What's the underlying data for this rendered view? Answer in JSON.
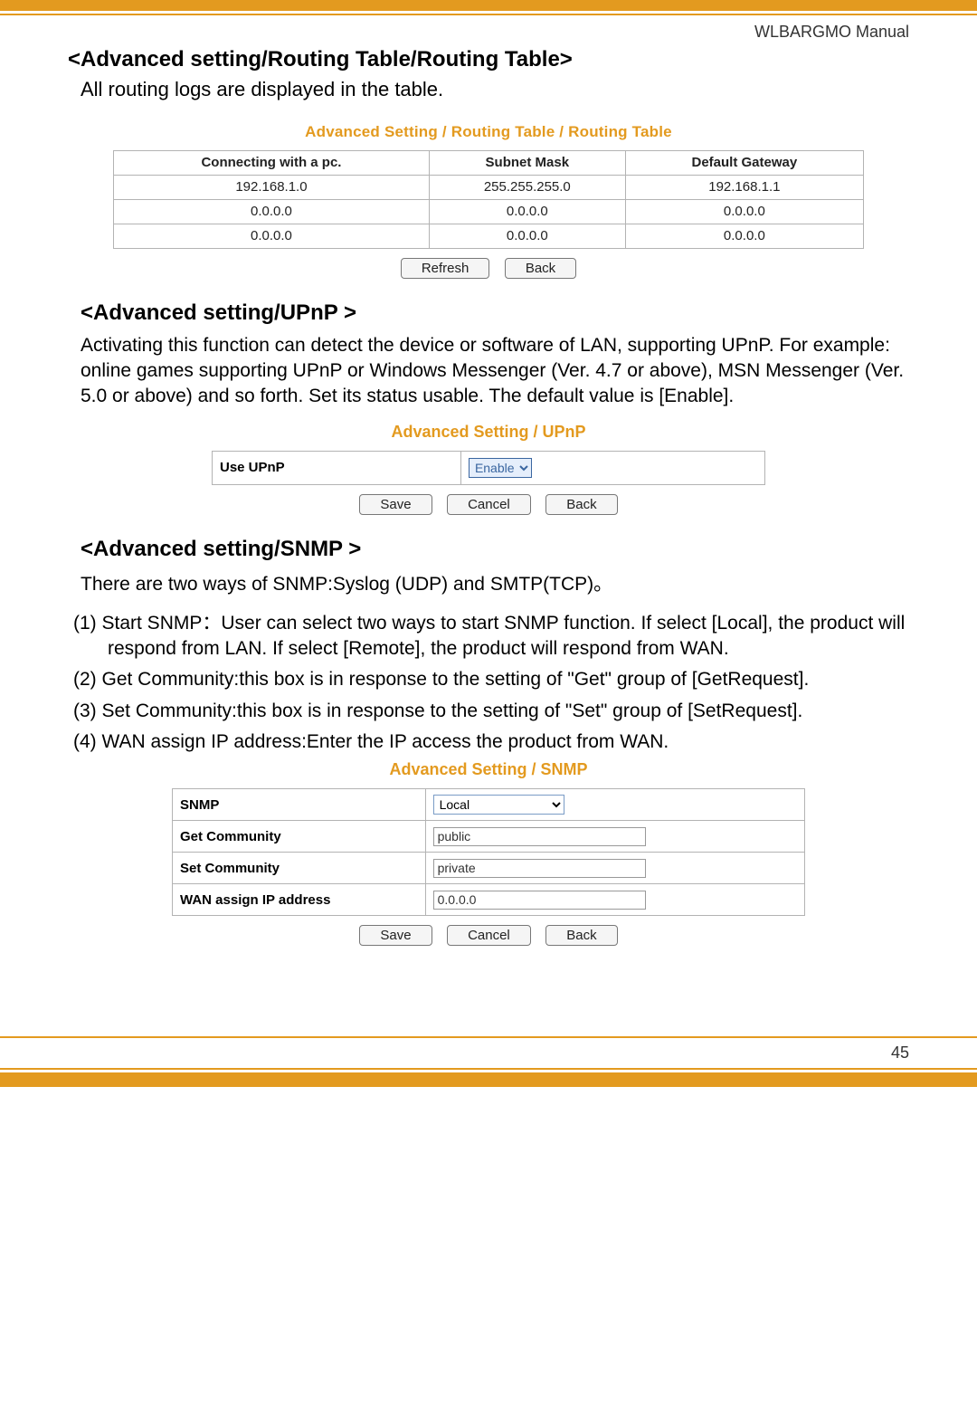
{
  "header": {
    "manual": "WLBARGMO Manual"
  },
  "routing": {
    "heading": "<Advanced setting/Routing Table/Routing Table>",
    "desc": "All routing logs are displayed in the table.",
    "caption": "Advanced Setting / Routing Table / Routing Table",
    "columns": [
      "Connecting with a pc.",
      "Subnet Mask",
      "Default Gateway"
    ],
    "rows": [
      [
        "192.168.1.0",
        "255.255.255.0",
        "192.168.1.1"
      ],
      [
        "0.0.0.0",
        "0.0.0.0",
        "0.0.0.0"
      ],
      [
        "0.0.0.0",
        "0.0.0.0",
        "0.0.0.0"
      ]
    ],
    "buttons": {
      "refresh": "Refresh",
      "back": "Back"
    }
  },
  "upnp": {
    "heading": "<Advanced setting/UPnP >",
    "desc": "Activating this function can detect the device or software of LAN, supporting UPnP.  For example: online games supporting UPnP or Windows Messenger (Ver. 4.7 or above), MSN Messenger (Ver. 5.0 or above) and so forth.  Set its status usable.  The default value is [Enable].",
    "caption": "Advanced Setting / UPnP",
    "label": "Use UPnP",
    "select_value": "Enable",
    "buttons": {
      "save": "Save",
      "cancel": "Cancel",
      "back": "Back"
    }
  },
  "snmp": {
    "heading": "<Advanced setting/SNMP >",
    "note": "There are two ways of SNMP:Syslog (UDP) and SMTP(TCP)。",
    "items": [
      "(1) Start SNMP：User can select two ways to start SNMP function. If select [Local], the product will respond from LAN. If select [Remote], the product will respond from WAN.",
      "(2) Get Community:this box is in response to the setting of \"Get\" group of [GetRequest].",
      "(3) Set Community:this box is in response to the setting of \"Set\" group of [SetRequest].",
      "(4) WAN assign IP address:Enter the IP access the product from WAN."
    ],
    "caption": "Advanced Setting / SNMP",
    "fields": {
      "snmp_label": "SNMP",
      "snmp_value": "Local",
      "get_label": "Get Community",
      "get_value": "public",
      "set_label": "Set Community",
      "set_value": "private",
      "wan_label": "WAN assign IP address",
      "wan_value": "0.0.0.0"
    },
    "buttons": {
      "save": "Save",
      "cancel": "Cancel",
      "back": "Back"
    }
  },
  "page_number": "45"
}
